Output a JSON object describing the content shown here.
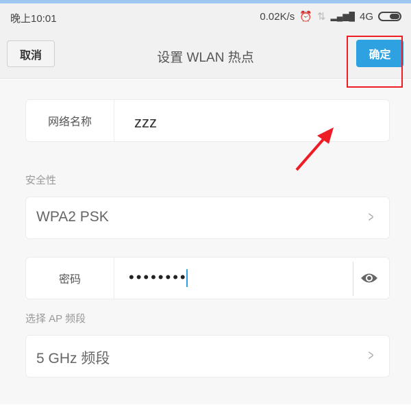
{
  "status_bar": {
    "time": "晚上10:01",
    "speed": "0.02K/s",
    "network": "4G",
    "icons": [
      "alarm-icon",
      "data-arrows-icon",
      "signal-icon",
      "battery-icon"
    ]
  },
  "header": {
    "cancel": "取消",
    "title": "设置 WLAN 热点",
    "confirm": "确定"
  },
  "form": {
    "network_name": {
      "label": "网络名称",
      "value": "zzz"
    },
    "security": {
      "label": "安全性",
      "value": "WPA2 PSK"
    },
    "password": {
      "label": "密码",
      "value": "••••••••"
    },
    "band": {
      "label": "选择 AP 频段",
      "value": "5 GHz 频段"
    }
  },
  "colors": {
    "accent": "#2ea2e0",
    "annotation": "#ee1c25"
  }
}
